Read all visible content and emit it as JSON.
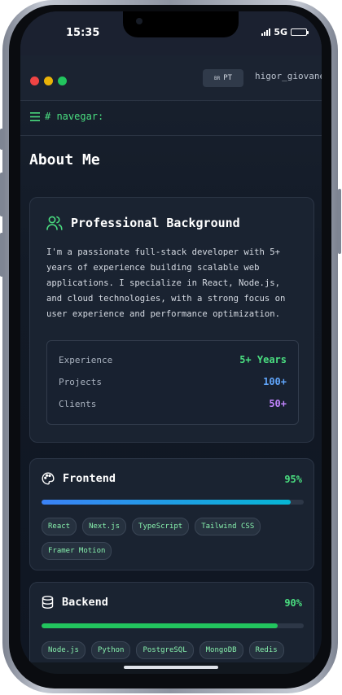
{
  "status_bar": {
    "time": "15:35",
    "network": "5G"
  },
  "window": {
    "lang_flag": "BR",
    "lang_code": "PT",
    "username": "higor_giovane",
    "traffic_lights": [
      "#ef4444",
      "#eab308",
      "#22c55e"
    ]
  },
  "nav": {
    "icon": "menu-icon",
    "label": "# navegar:"
  },
  "page": {
    "title": "About Me"
  },
  "background": {
    "icon": "users-icon",
    "title": "Professional Background",
    "bio": "I'm a passionate full-stack developer with 5+ years of experience building scalable web applications. I specialize in React, Node.js, and cloud technologies, with a strong focus on user experience and performance optimization.",
    "stats": [
      {
        "label": "Experience",
        "value": "5+ Years",
        "color": "#4ade80"
      },
      {
        "label": "Projects",
        "value": "100+",
        "color": "#60a5fa"
      },
      {
        "label": "Clients",
        "value": "50+",
        "color": "#c084fc"
      }
    ]
  },
  "skills": [
    {
      "icon": "palette-icon",
      "title": "Frontend",
      "percent_label": "95%",
      "level": 0.95,
      "bar_color": "#3b82f6",
      "bar_color_end": "#06b6d4",
      "tags": [
        "React",
        "Next.js",
        "TypeScript",
        "Tailwind CSS",
        "Framer Motion"
      ]
    },
    {
      "icon": "database-icon",
      "title": "Backend",
      "percent_label": "90%",
      "level": 0.9,
      "bar_color": "#22c55e",
      "bar_color_end": "#22c55e",
      "tags": [
        "Node.js",
        "Python",
        "PostgreSQL",
        "MongoDB",
        "Redis"
      ]
    }
  ],
  "colors": {
    "accent": "#4ade80",
    "background": "#121a26",
    "card": "#1a2331"
  }
}
